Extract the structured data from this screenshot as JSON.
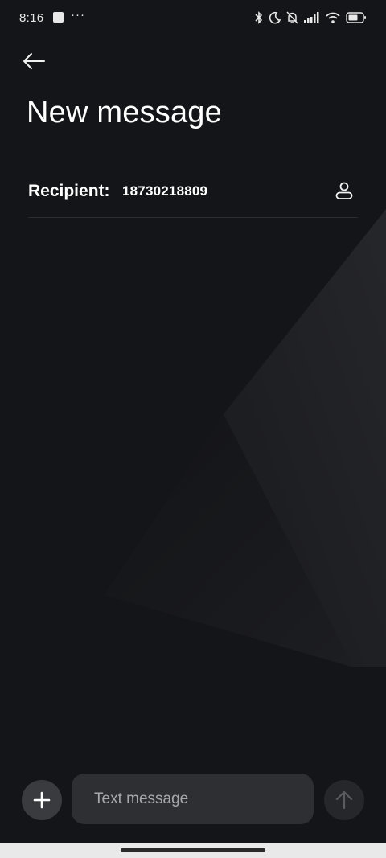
{
  "status_bar": {
    "time": "8:16",
    "more_indicator": "···",
    "icons": [
      "app-notification-icon",
      "bluetooth-icon",
      "do-not-disturb-icon",
      "silent-icon",
      "signal-icon",
      "wifi-icon",
      "battery-icon"
    ]
  },
  "header": {
    "back_icon": "back-arrow-icon",
    "title": "New message"
  },
  "recipient": {
    "label": "Recipient:",
    "value": "18730218809",
    "contact_icon": "contact-person-icon"
  },
  "composer": {
    "add_icon": "plus-icon",
    "placeholder": "Text message",
    "value": "",
    "send_icon": "send-arrow-icon"
  },
  "colors": {
    "background": "#141518",
    "input_background": "#2e2f33",
    "add_button_background": "#3a3b3f",
    "send_button_background": "#26272a",
    "nav_bar": "#e9e9ea"
  }
}
